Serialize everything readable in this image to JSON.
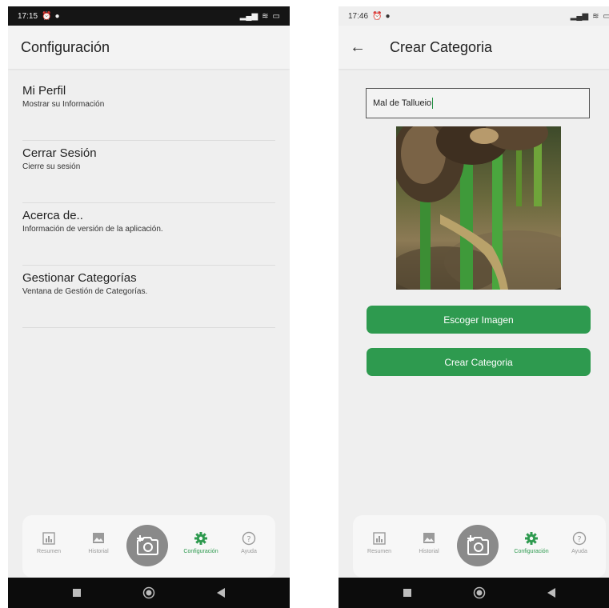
{
  "left": {
    "status": {
      "time": "17:15"
    },
    "appbar": {
      "title": "Configuración"
    },
    "menu": [
      {
        "title": "Mi Perfil",
        "subtitle": "Mostrar su Información"
      },
      {
        "title": "Cerrar Sesión",
        "subtitle": "Cierre su sesión"
      },
      {
        "title": "Acerca de..",
        "subtitle": "Información de versión de la aplicación."
      },
      {
        "title": "Gestionar Categorías",
        "subtitle": "Ventana de Gestión de Categorías."
      }
    ]
  },
  "right": {
    "status": {
      "time": "17:46"
    },
    "appbar": {
      "title": "Crear Categoria"
    },
    "form": {
      "category_name": "Mal de Tallueio",
      "pick_image_label": "Escoger Imagen",
      "create_label": "Crear Categoria"
    }
  },
  "nav": {
    "items": [
      {
        "label": "Resumen",
        "icon": "chart-icon"
      },
      {
        "label": "Historial",
        "icon": "gallery-icon"
      },
      {
        "label": "Configuración",
        "icon": "gear-icon"
      },
      {
        "label": "Ayuda",
        "icon": "help-icon"
      }
    ],
    "camera_icon": "camera-plus-icon"
  },
  "colors": {
    "accent": "#2e9a4f",
    "camera_button": "#8a8a8a",
    "status_bar_dark": "#151515",
    "system_nav": "#0c0c0c"
  }
}
